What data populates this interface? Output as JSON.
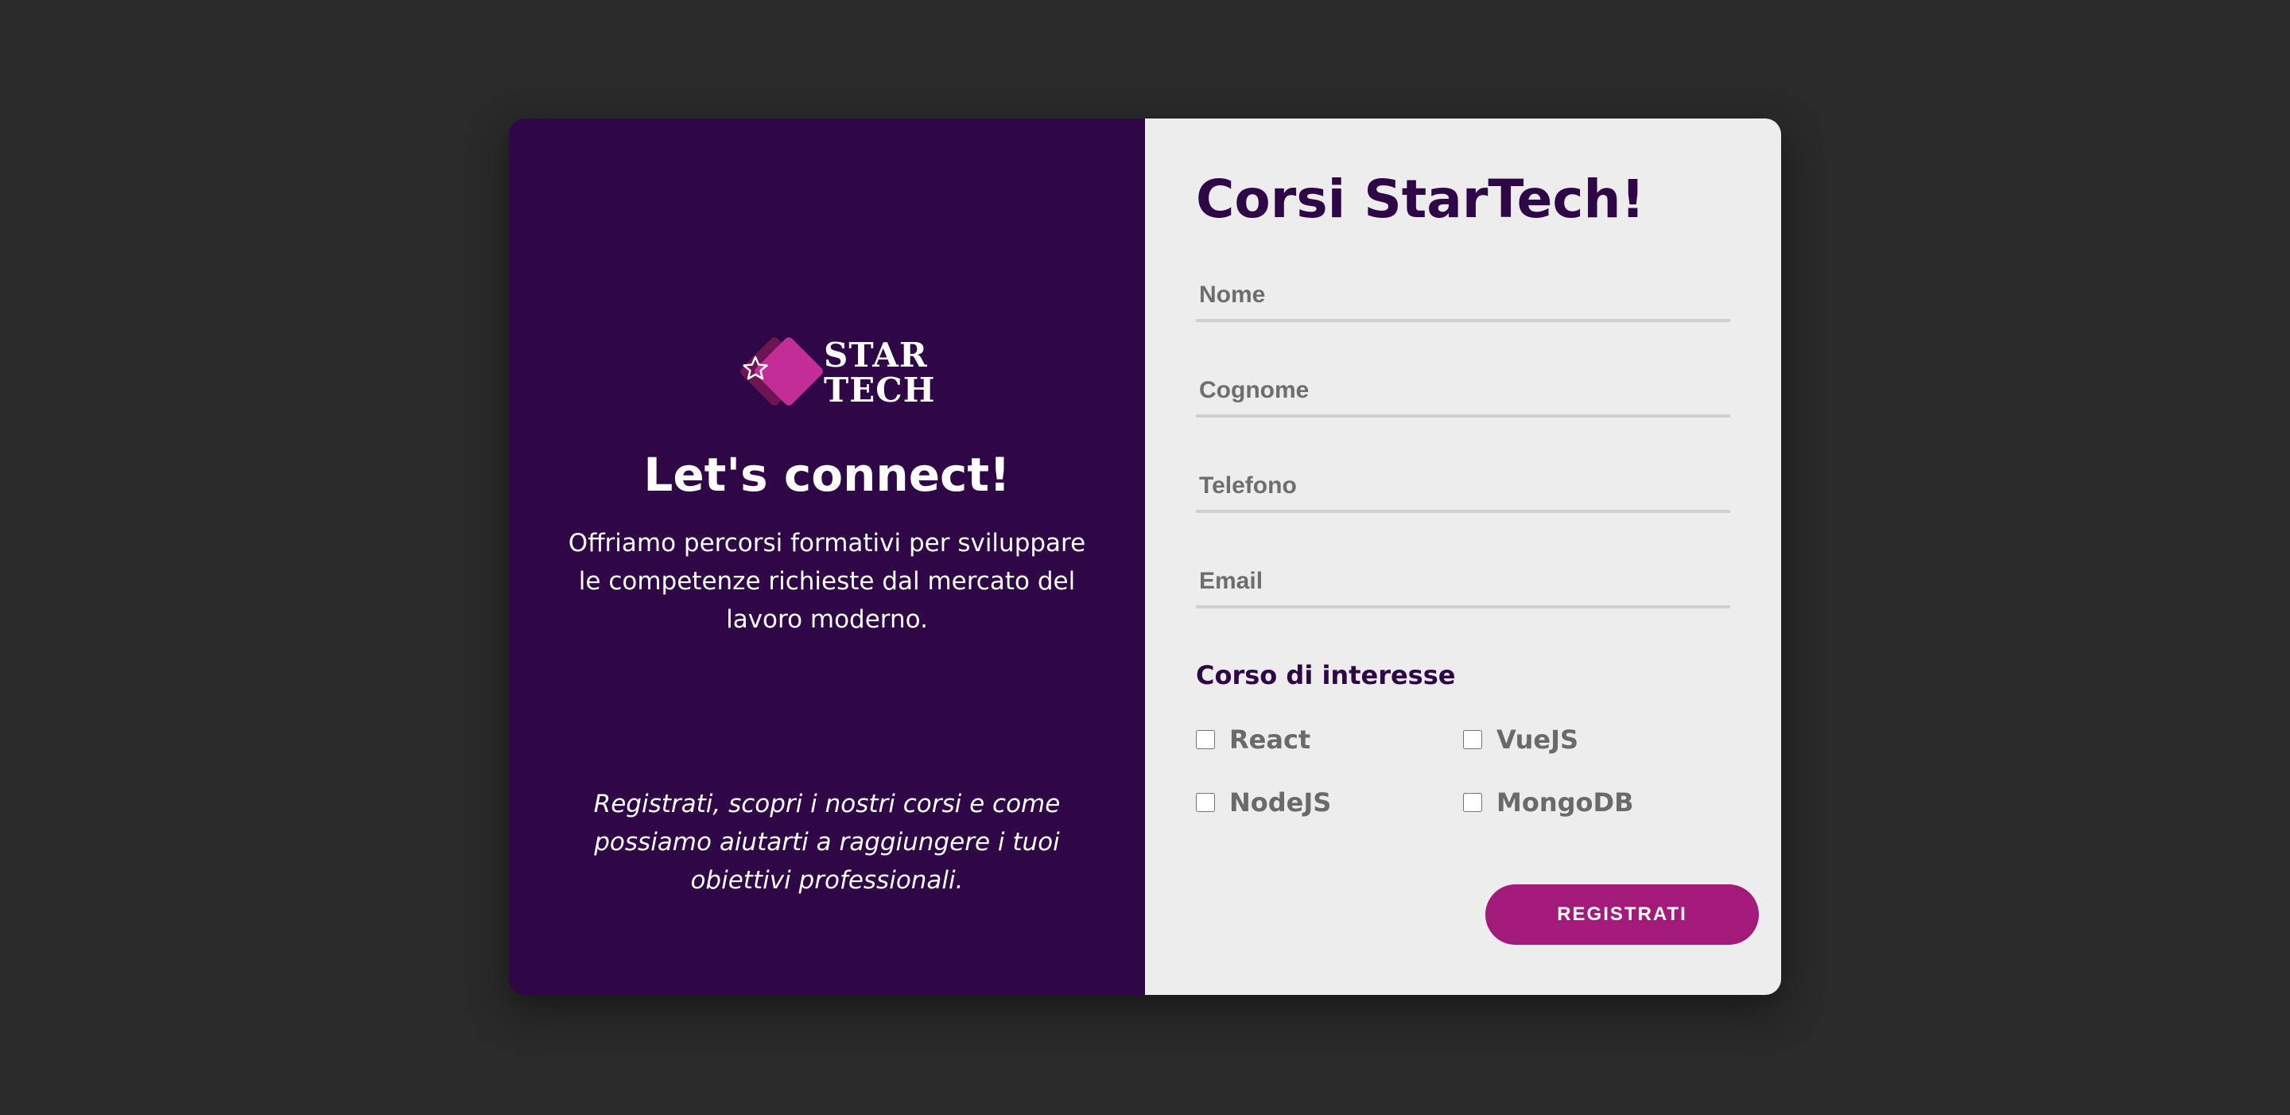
{
  "brand": {
    "logo_line1": "STAR",
    "logo_line2": "TECH",
    "icon": "star-diamond-icon",
    "colors": {
      "panel": "#2f0646",
      "accent": "#a41a7b",
      "form_bg": "#ededed",
      "page_bg": "#2a2a2a"
    }
  },
  "intro": {
    "title": "Let's connect!",
    "description": "Offriamo percorsi formativi per sviluppare le competenze richieste dal mercato del lavoro moderno.",
    "cta": "Registrati, scopri i nostri corsi e come possiamo aiutarti a raggiungere i tuoi obiettivi professionali."
  },
  "form": {
    "title": "Corsi StarTech!",
    "fields": {
      "nome": {
        "placeholder": "Nome",
        "value": ""
      },
      "cognome": {
        "placeholder": "Cognome",
        "value": ""
      },
      "telefono": {
        "placeholder": "Telefono",
        "value": ""
      },
      "email": {
        "placeholder": "Email",
        "value": ""
      }
    },
    "courses_label": "Corso di interesse",
    "courses": [
      {
        "label": "React",
        "checked": false
      },
      {
        "label": "VueJS",
        "checked": false
      },
      {
        "label": "NodeJS",
        "checked": false
      },
      {
        "label": "MongoDB",
        "checked": false
      }
    ],
    "submit_label": "REGISTRATI"
  }
}
